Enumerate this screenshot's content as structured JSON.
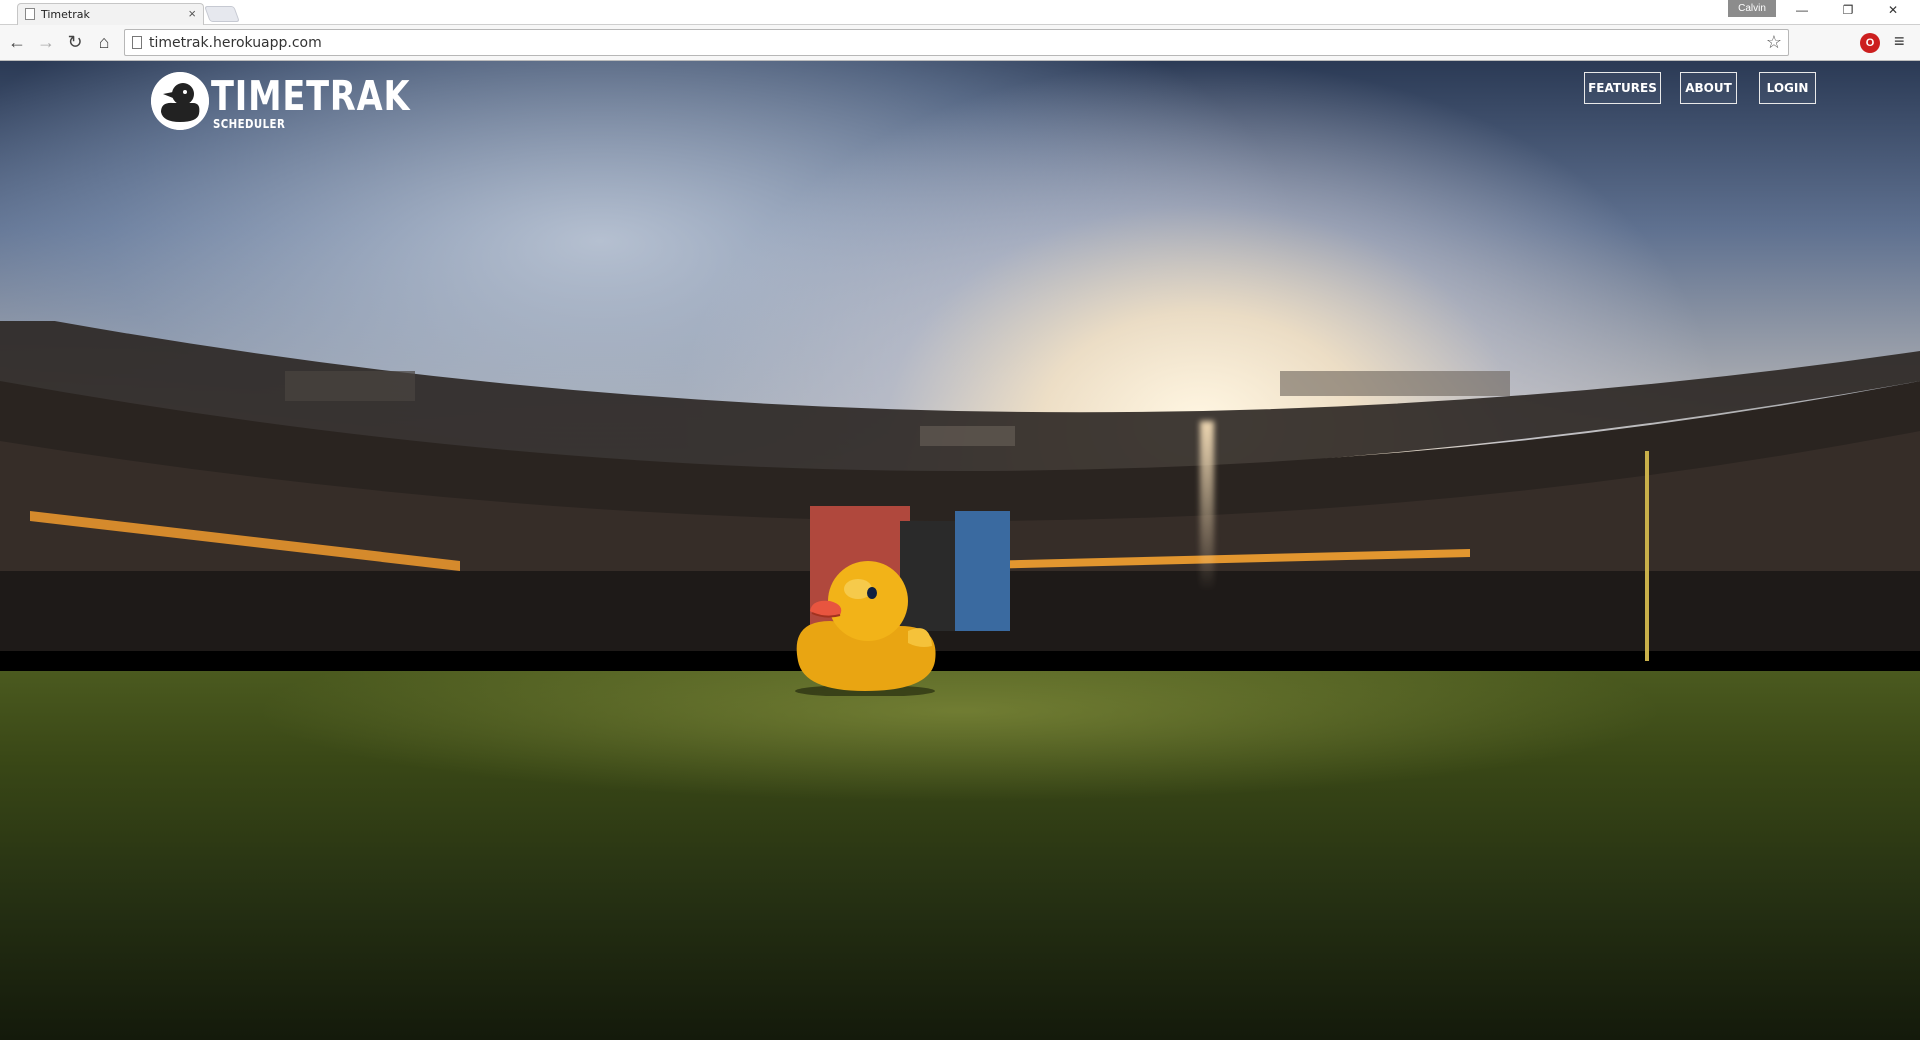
{
  "browser": {
    "tab_title": "Timetrak",
    "tab_close": "×",
    "profile_name": "Calvin",
    "url": "timetrak.herokuapp.com",
    "icons": {
      "back": "arrow-left-icon",
      "forward": "arrow-right-icon",
      "reload": "reload-icon",
      "home": "home-icon",
      "bookmark": "star-icon",
      "extension": "opera-icon",
      "menu": "hamburger-menu-icon"
    }
  },
  "site": {
    "brand_name": "TIMETRAK",
    "brand_sub": "SCHEDULER",
    "nav": {
      "features": "FEATURES",
      "about": "ABOUT",
      "login": "LOGIN"
    }
  },
  "colors": {
    "nav_border": "#e9e9e9",
    "text_on_hero": "#ffffff",
    "duck_yellow": "#f2b318"
  }
}
